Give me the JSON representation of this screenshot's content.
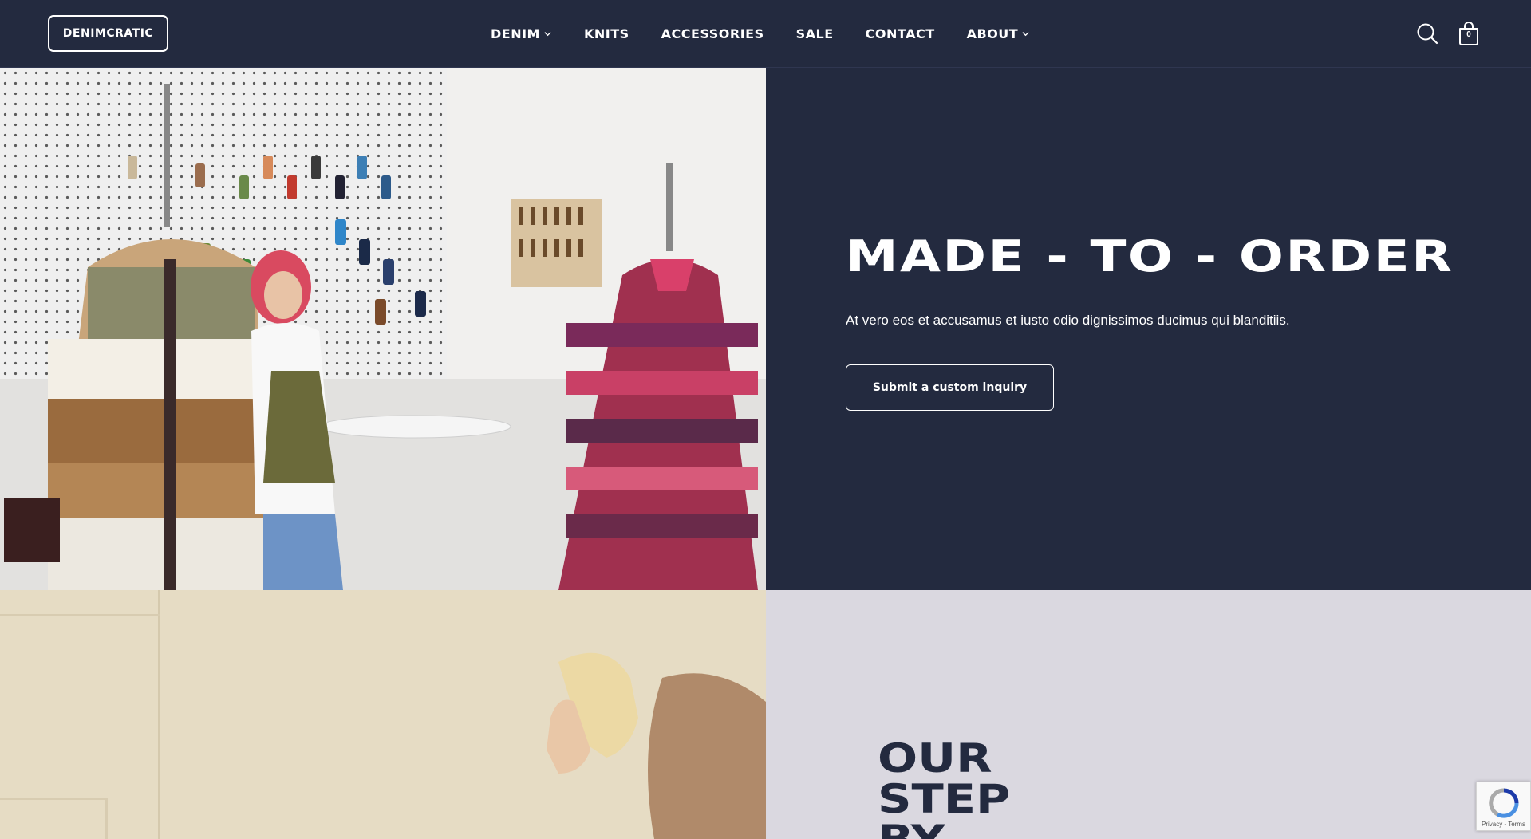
{
  "header": {
    "logo": "DENIMCRATIC",
    "nav": [
      {
        "label": "DENIM",
        "has_dropdown": true
      },
      {
        "label": "KNITS",
        "has_dropdown": false
      },
      {
        "label": "ACCESSORIES",
        "has_dropdown": false
      },
      {
        "label": "SALE",
        "has_dropdown": false
      },
      {
        "label": "CONTACT",
        "has_dropdown": false
      },
      {
        "label": "ABOUT",
        "has_dropdown": true
      }
    ],
    "icons": {
      "search": "search-icon",
      "cart": "shopping-bag-icon"
    },
    "cart_count": "0"
  },
  "hero": {
    "title": "MADE - TO - ORDER",
    "subtitle": "At vero eos et accusamus et iusto odio dignissimos ducimus qui blanditiis.",
    "button_label": "Submit a custom inquiry",
    "image": "studio photo of woman with two mannequins wearing patchwork coats"
  },
  "section2": {
    "title_lines": [
      "OUR",
      "STEP",
      "BY"
    ],
    "image": "woman with blonde hair against beige wall"
  },
  "recaptcha": {
    "terms": "Privacy - Terms"
  },
  "colors": {
    "navy": "#232a3f",
    "lavender": "#dad8e0",
    "white": "#ffffff"
  }
}
